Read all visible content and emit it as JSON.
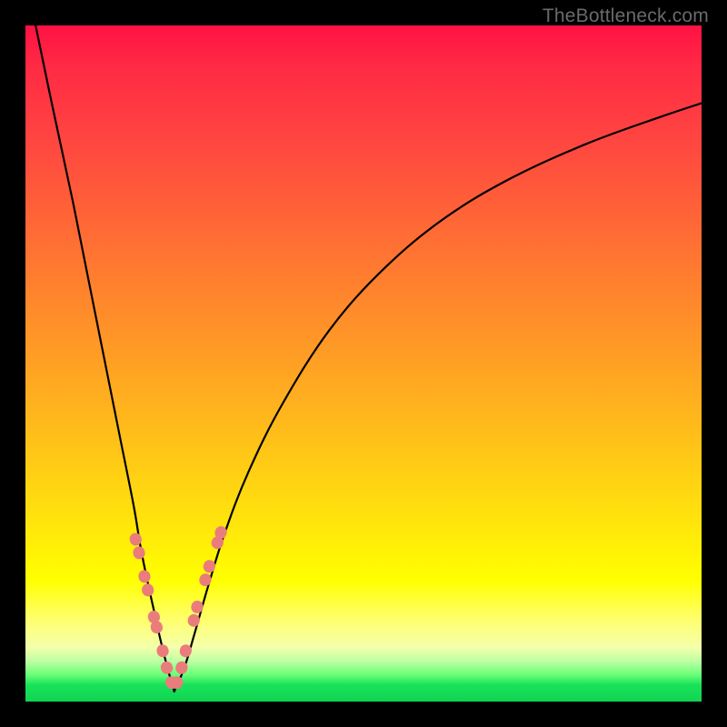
{
  "watermark": "TheBottleneck.com",
  "colors": {
    "frame": "#000000",
    "curve": "#000000",
    "dot": "#eb7c7c",
    "gradient_top": "#ff1144",
    "gradient_bottom": "#10d452"
  },
  "chart_data": {
    "type": "line",
    "title": "",
    "xlabel": "",
    "ylabel": "",
    "xlim": [
      0,
      100
    ],
    "ylim": [
      0,
      100
    ],
    "note": "Axes have no visible tick labels. x/y expressed as percent of plot area (0..100). y=0 is bottom (green), y=100 is top (red). Curve appears to be a V/valley shape with minimum near x≈22, y≈1.",
    "series": [
      {
        "name": "left-branch",
        "x": [
          1.5,
          4,
          7,
          10,
          12,
          14,
          16,
          17,
          18,
          19,
          20,
          21,
          22
        ],
        "y": [
          100,
          88,
          74,
          59,
          49,
          39,
          29,
          23,
          18,
          13.5,
          9,
          5,
          1.5
        ]
      },
      {
        "name": "right-branch",
        "x": [
          22,
          23.5,
          25,
          27,
          29.5,
          33,
          38,
          45,
          53,
          62,
          72,
          83,
          94,
          100
        ],
        "y": [
          1.5,
          5,
          10,
          17,
          25,
          34,
          44,
          55,
          64,
          71.5,
          77.5,
          82.5,
          86.5,
          88.5
        ]
      }
    ],
    "highlight_points": {
      "name": "salmon-dots",
      "note": "Clustered capsule-like markers near the valley on both branches, roughly in the yellow band (y ~8–24).",
      "points": [
        {
          "x": 16.3,
          "y": 24
        },
        {
          "x": 16.8,
          "y": 22
        },
        {
          "x": 17.6,
          "y": 18.5
        },
        {
          "x": 18.1,
          "y": 16.5
        },
        {
          "x": 19.0,
          "y": 12.5
        },
        {
          "x": 19.4,
          "y": 11
        },
        {
          "x": 20.3,
          "y": 7.5
        },
        {
          "x": 20.9,
          "y": 5
        },
        {
          "x": 21.6,
          "y": 2.8
        },
        {
          "x": 22.4,
          "y": 2.8
        },
        {
          "x": 23.1,
          "y": 5
        },
        {
          "x": 23.7,
          "y": 7.5
        },
        {
          "x": 24.9,
          "y": 12
        },
        {
          "x": 25.4,
          "y": 14
        },
        {
          "x": 26.6,
          "y": 18
        },
        {
          "x": 27.2,
          "y": 20
        },
        {
          "x": 28.4,
          "y": 23.5
        },
        {
          "x": 28.9,
          "y": 25
        }
      ]
    }
  }
}
